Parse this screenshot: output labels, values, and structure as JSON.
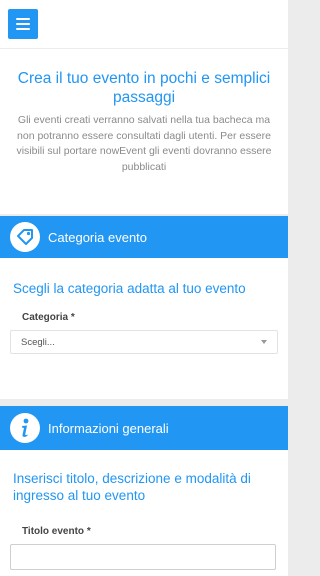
{
  "header": {
    "menu_icon": "hamburger-icon",
    "accent_color": "#2196f3"
  },
  "intro": {
    "title": "Crea il tuo evento in pochi e semplici passaggi",
    "description": "Gli eventi creati verranno salvati nella tua bacheca ma non potranno essere consultati dagli utenti. Per essere visibili sul portare nowEvent gli eventi dovranno essere pubblicati"
  },
  "category_section": {
    "icon": "tag-icon",
    "title": "Categoria evento",
    "heading": "Scegli la categoria adatta al tuo evento",
    "field_label": "Categoria *",
    "select_value": "Scegli..."
  },
  "info_section": {
    "icon": "info-icon",
    "title": "Informazioni generali",
    "heading": "Inserisci titolo, descrizione e modalità di ingresso al tuo evento",
    "field_label": "Titolo evento *",
    "title_value": ""
  }
}
